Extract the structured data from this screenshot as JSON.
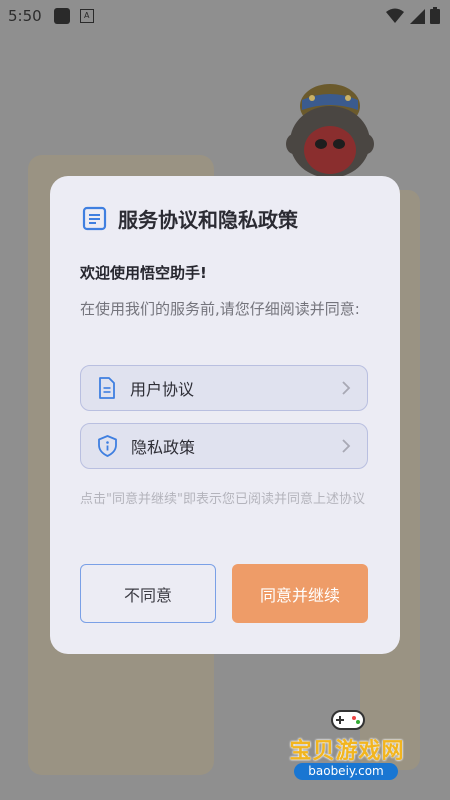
{
  "status_bar": {
    "time": "5:50",
    "badge": "A"
  },
  "dialog": {
    "title": "服务协议和隐私政策",
    "welcome": "欢迎使用悟空助手!",
    "intro": "在使用我们的服务前,请您仔细阅读并同意:",
    "links": [
      {
        "label": "用户协议",
        "icon": "document-icon"
      },
      {
        "label": "隐私政策",
        "icon": "shield-info-icon"
      }
    ],
    "notice": "点击\"同意并继续\"即表示您已阅读并同意上述协议",
    "buttons": {
      "disagree": "不同意",
      "agree": "同意并继续"
    }
  },
  "watermark": {
    "brand": "宝贝游戏网",
    "url": "baobeiy.com"
  },
  "colors": {
    "accent_blue": "#3f7fe0",
    "agree_button": "#ee9c68",
    "disagree_border": "#7aa0e6",
    "dialog_bg": "#ececf4",
    "overlay": "#8f8f8f"
  }
}
